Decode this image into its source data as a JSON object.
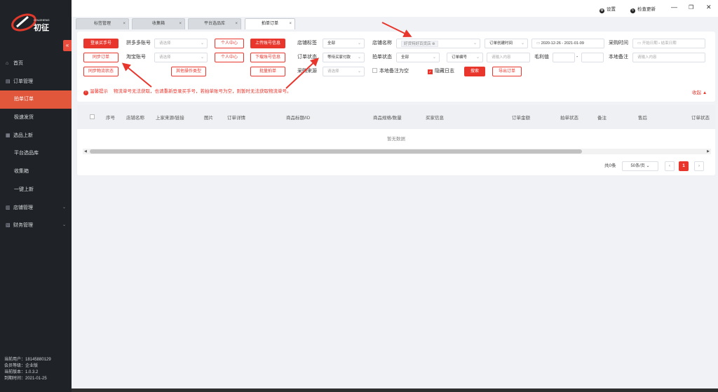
{
  "app": {
    "logo_text": "初征",
    "logo_sub": "CHUZHENG",
    "collapse_glyph": "«"
  },
  "sidebar": {
    "items": [
      {
        "label": "首页",
        "icon": "home-icon",
        "glyph": "⌂"
      },
      {
        "label": "订单管理",
        "icon": "order-icon",
        "glyph": "▤"
      },
      {
        "label": "拍单订单"
      },
      {
        "label": "极速发货"
      },
      {
        "label": "选品上新",
        "icon": "product-icon",
        "glyph": "▦"
      },
      {
        "label": "平台选品库"
      },
      {
        "label": "收集箱"
      },
      {
        "label": "一键上新"
      },
      {
        "label": "店铺管理",
        "icon": "store-icon",
        "glyph": "▥"
      },
      {
        "label": "财务管理",
        "icon": "finance-icon",
        "glyph": "▧"
      }
    ],
    "user": {
      "current_user": "当前用户：18145880129",
      "member_level": "会员等级：企业版",
      "version": "当前版本：1.0.3.2",
      "expire": "到期时间：2021-01-25"
    }
  },
  "topbar": {
    "settings": "设置",
    "check_update": "检查更新",
    "minimize": "—",
    "restore": "❐",
    "close": "✕"
  },
  "tabs": [
    {
      "label": "标签管理"
    },
    {
      "label": "收集箱"
    },
    {
      "label": "平台选品库"
    },
    {
      "label": "拍单订单"
    }
  ],
  "filters": {
    "btn_login_buyer": "登录买手号",
    "btn_sync_order": "同步订单",
    "btn_sync_logistics": "同步物流状态",
    "pdd_account_label": "拼多多账号",
    "pdd_account_placeholder": "请选择",
    "taobao_account_label": "淘宝账号",
    "taobao_account_placeholder": "请选择",
    "btn_personal_center_1": "个人中心",
    "btn_personal_center_2": "个人中心",
    "btn_other_ops": "其他操作类型",
    "btn_upload_account": "上传账号信息",
    "btn_download_account": "下载账号信息",
    "btn_batch_order": "批量拍单",
    "store_tag_label": "店铺标签",
    "store_tag_value": "全部",
    "order_status_label": "订单状态",
    "order_status_value": "等待买家付款",
    "purchase_source_label": "采购来源",
    "purchase_source_placeholder": "请选择",
    "store_name_label": "店铺名称",
    "store_name_chip": "好货特好百货店",
    "order_status2_label": "拍单状态",
    "order_status2_value": "全部",
    "local_note_empty": "本地备注为空",
    "order_time_value": "订单创建时间",
    "date_range": "2020-12-26 - 2021-01-09",
    "order_no_select": "订单编号",
    "order_no_placeholder": "请输入内容",
    "hide_log": "隐藏日志",
    "btn_search": "搜索",
    "btn_export": "导出订单",
    "purchase_time_label": "采购时间",
    "purchase_start": "开始日期",
    "purchase_sep": "-",
    "purchase_end": "结束日期",
    "gross_profit_label": "毛利值",
    "gross_sep": "-",
    "local_note_label": "本地备注",
    "local_note_placeholder": "请输入内容",
    "warning_title": "温馨提示",
    "warning_text": "物流单号无法获取，也请重新登录买手号，若拍单账号为空，则暂时无法获取物流单号。",
    "collapse": "收起"
  },
  "table": {
    "columns": [
      "序号",
      "店铺名称",
      "上家来源/链接",
      "图片",
      "订单详情",
      "商品标题/ID",
      "商品规格/数量",
      "买家信息",
      "订单金额",
      "拍单状态",
      "备注",
      "售后",
      "订单状态"
    ],
    "empty": "暂无数据",
    "total": "共0条",
    "page_size": "50条/页",
    "current_page": "1",
    "prev": "‹",
    "next": "›"
  }
}
